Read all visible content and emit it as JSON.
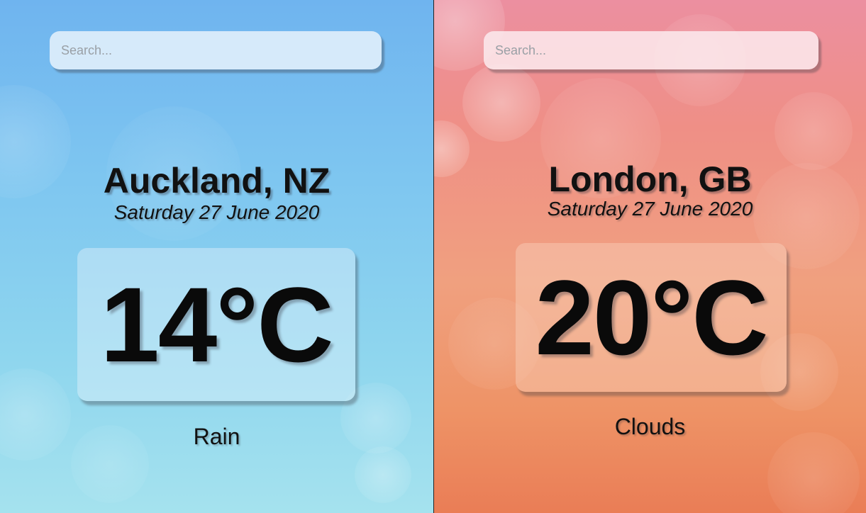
{
  "panels": [
    {
      "search": {
        "placeholder": "Search...",
        "value": ""
      },
      "location": "Auckland, NZ",
      "date": "Saturday 27 June 2020",
      "temperature": "14°C",
      "condition": "Rain",
      "theme": {
        "top": "#6fb4ef",
        "bottom": "#a5e2ee"
      }
    },
    {
      "search": {
        "placeholder": "Search...",
        "value": ""
      },
      "location": "London, GB",
      "date": "Saturday 27 June 2020",
      "temperature": "20°C",
      "condition": "Clouds",
      "theme": {
        "top": "#ec8fa0",
        "bottom": "#ea7d56"
      }
    }
  ]
}
